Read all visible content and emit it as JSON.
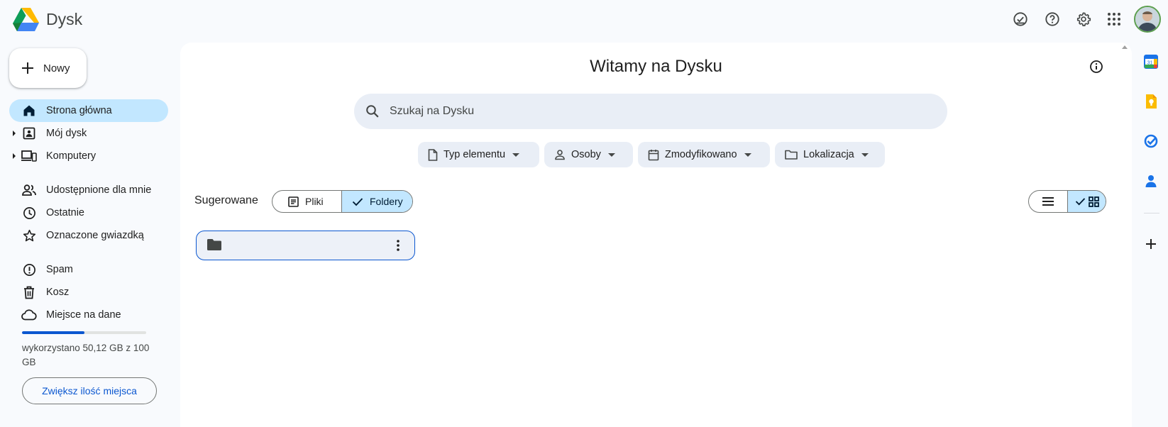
{
  "header": {
    "app_title": "Dysk",
    "icons": [
      "ready-for-offline-icon",
      "help-icon",
      "settings-icon",
      "apps-grid-icon",
      "account-avatar"
    ]
  },
  "sidebar": {
    "new_label": "Nowy",
    "items": [
      {
        "label": "Strona główna",
        "icon": "home-icon",
        "active": true
      },
      {
        "label": "Mój dysk",
        "icon": "my-drive-icon",
        "expandable": true
      },
      {
        "label": "Komputery",
        "icon": "computers-icon",
        "expandable": true
      },
      {
        "label": "Udostępnione dla mnie",
        "icon": "shared-icon"
      },
      {
        "label": "Ostatnie",
        "icon": "clock-icon"
      },
      {
        "label": "Oznaczone gwiazdką",
        "icon": "star-icon"
      },
      {
        "label": "Spam",
        "icon": "spam-icon"
      },
      {
        "label": "Kosz",
        "icon": "trash-icon"
      },
      {
        "label": "Miejsce na dane",
        "icon": "cloud-icon"
      }
    ],
    "storage": {
      "used_fraction": 0.5012,
      "text": "wykorzystano 50,12 GB z 100 GB",
      "upgrade_label": "Zwiększ ilość miejsca"
    }
  },
  "main": {
    "title": "Witamy na Dysku",
    "search_placeholder": "Szukaj na Dysku",
    "filters": [
      {
        "label": "Typ elementu",
        "icon": "file-icon"
      },
      {
        "label": "Osoby",
        "icon": "person-icon"
      },
      {
        "label": "Zmodyfikowano",
        "icon": "calendar-icon"
      },
      {
        "label": "Lokalizacja",
        "icon": "folder-outline-icon"
      }
    ],
    "suggested_label": "Sugerowane",
    "segments": {
      "files": "Pliki",
      "folders": "Foldery",
      "selected": "folders"
    },
    "view_selected": "grid",
    "folders": [
      {
        "name": ""
      }
    ]
  },
  "right_rail": {
    "icons": [
      "calendar-app-icon",
      "keep-app-icon",
      "tasks-app-icon",
      "contacts-app-icon",
      "add-app-icon"
    ],
    "colors": {
      "calendar": "#1a73e8",
      "keep": "#fbbc04",
      "tasks": "#1a73e8",
      "contacts": "#1a73e8"
    }
  },
  "colors": {
    "accent": "#0b57d0",
    "active_bg": "#c2e7ff",
    "page_bg": "#f8fafd",
    "search_bg": "#e9eef6"
  }
}
